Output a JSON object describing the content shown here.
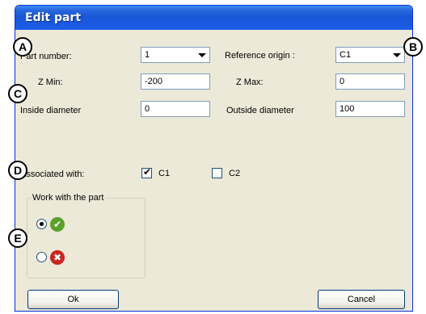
{
  "dialog": {
    "title": "Edit part",
    "part_number": {
      "label": "Part number:",
      "value": "1"
    },
    "reference_origin": {
      "label": "Reference origin :",
      "value": "C1"
    },
    "z_min": {
      "label": "Z Min:",
      "value": "-200"
    },
    "z_max": {
      "label": "Z Max:",
      "value": "0"
    },
    "inside_diameter": {
      "label": "Inside diameter",
      "value": "0"
    },
    "outside_diameter": {
      "label": "Outside diameter",
      "value": "100"
    },
    "associated_with": {
      "label": "Associated with:",
      "options": [
        {
          "label": "C1",
          "checked": true
        },
        {
          "label": "C2",
          "checked": false
        }
      ]
    },
    "work_group": {
      "legend": "Work with the part",
      "options": [
        {
          "icon": "check-circle-icon",
          "selected": true
        },
        {
          "icon": "cross-circle-icon",
          "selected": false
        }
      ]
    },
    "ok_label": "Ok",
    "cancel_label": "Cancel"
  },
  "markers": [
    "A",
    "B",
    "C",
    "D",
    "E"
  ],
  "colors": {
    "titlebar": "#1856d6",
    "dialog_bg": "#ece9d8",
    "ok_icon": "#5aa12a",
    "cancel_icon": "#c8261e"
  }
}
